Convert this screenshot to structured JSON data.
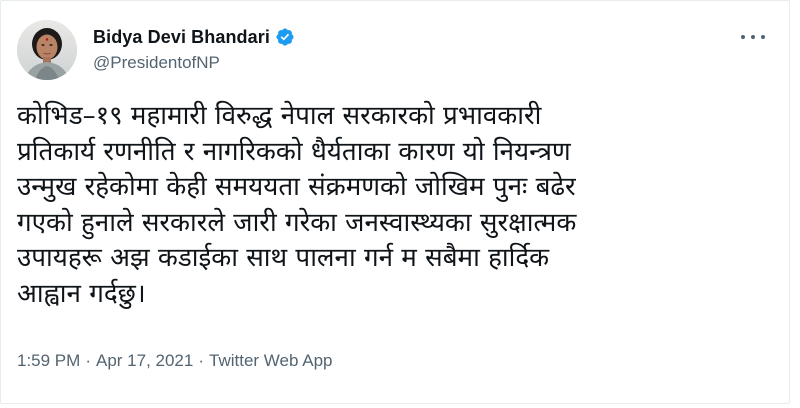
{
  "tweet": {
    "author": {
      "display_name": "Bidya Devi Bhandari",
      "handle": "@PresidentofNP",
      "verified": true
    },
    "text_lines": [
      "कोभिड–१९ महामारी विरुद्ध नेपाल सरकारको प्रभावकारी",
      "प्रतिकार्य रणनीति र नागरिकको धैर्यताका कारण यो नियन्त्रण",
      "उन्मुख रहेकोमा केही समययता संक्रमणको जोखिम पुनः बढेर",
      "गएको हुनाले सरकारले जारी गरेका जनस्वास्थ्यका सुरक्षात्मक",
      "उपायहरू अझ कडाईका साथ पालना गर्न म सबैमा हार्दिक",
      "आह्वान गर्दछु।"
    ],
    "meta": {
      "time": "1:59 PM",
      "separator": "·",
      "date": "Apr 17, 2021",
      "source": "Twitter Web App"
    }
  },
  "icons": {
    "verified_badge": "verified-badge-icon",
    "more_options": "more-options-icon"
  },
  "colors": {
    "text_primary": "#0f1419",
    "text_secondary": "#536471",
    "verified_blue": "#1d9bf0",
    "border": "#e6ecf0"
  }
}
